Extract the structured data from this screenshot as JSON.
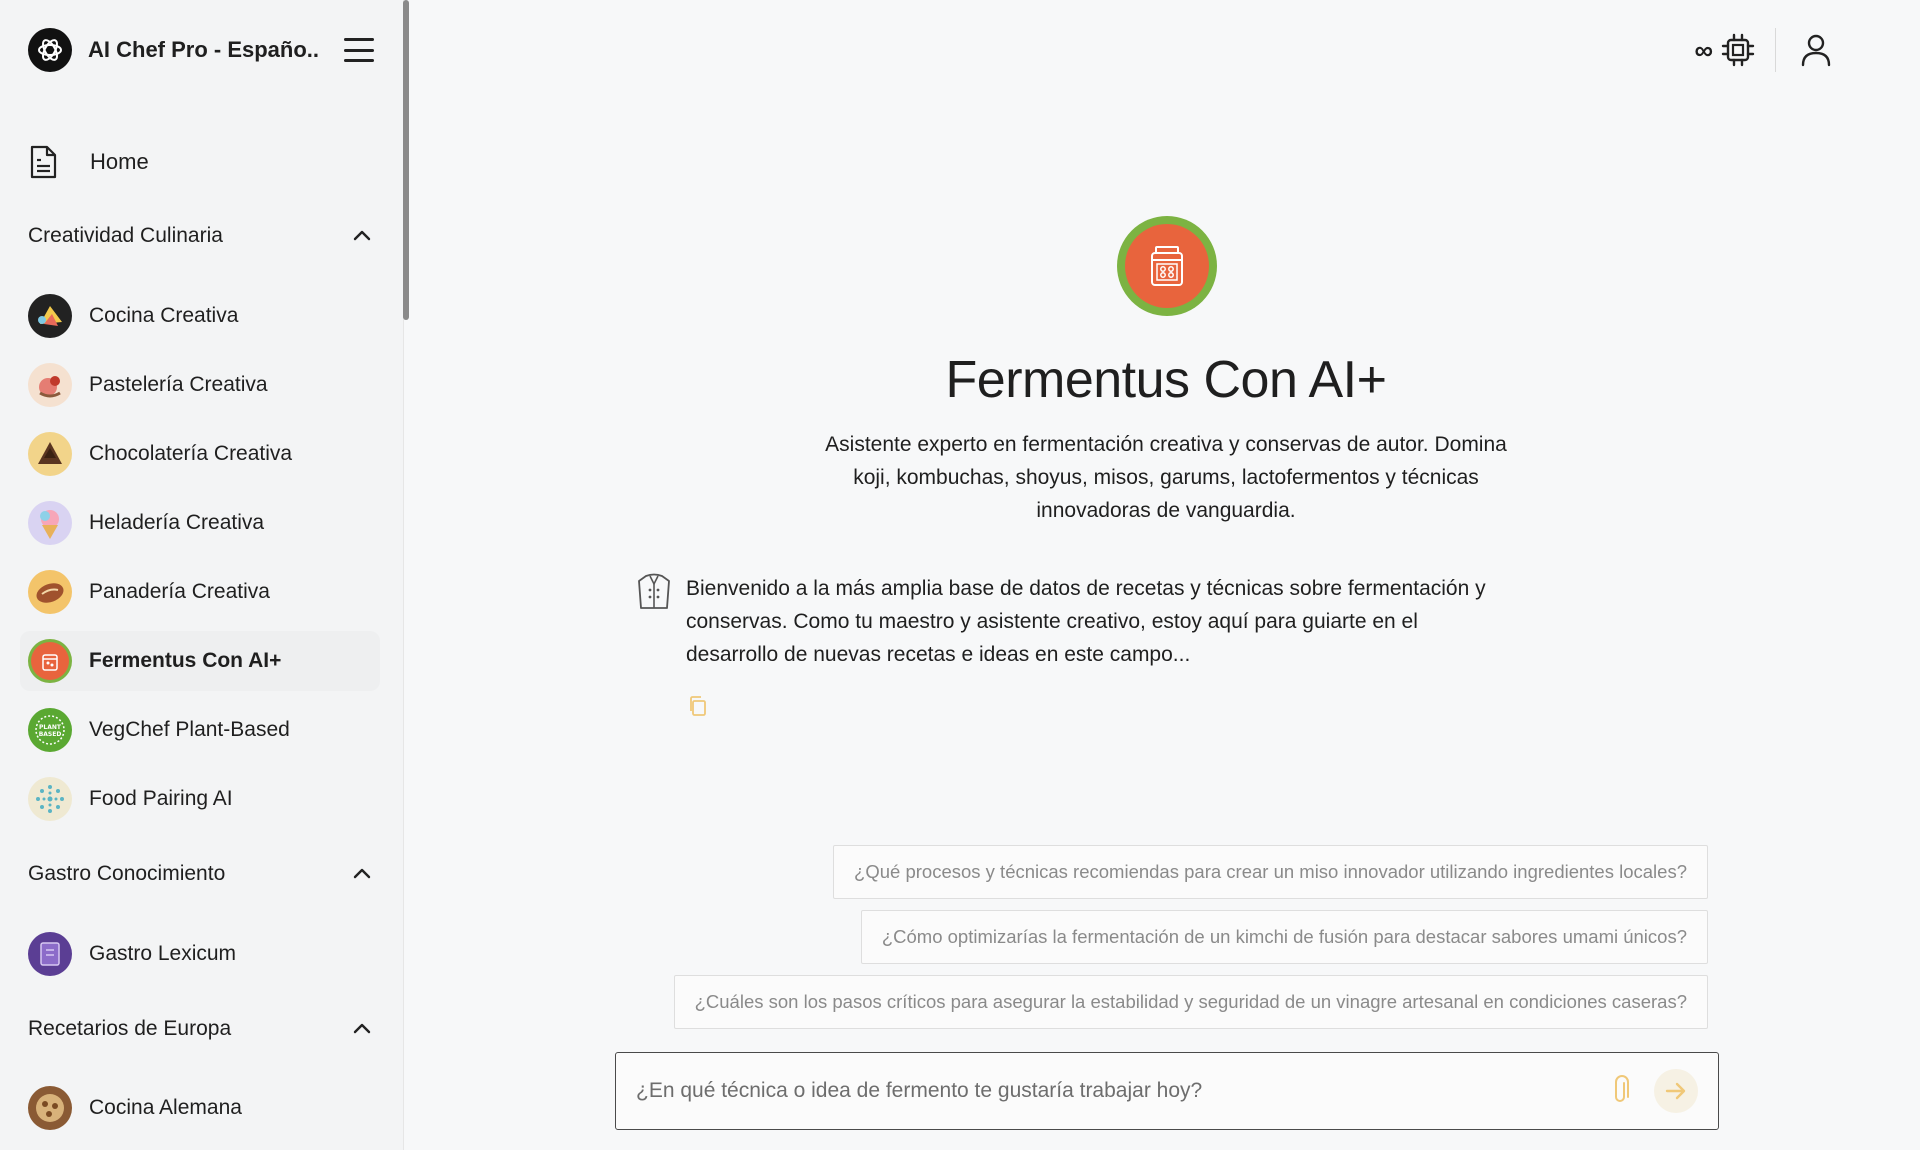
{
  "app": {
    "title": "AI Chef Pro - Españo..."
  },
  "sidebar": {
    "home_label": "Home",
    "sections": [
      {
        "title": "Creatividad Culinaria",
        "items": [
          {
            "label": "Cocina Creativa",
            "icon": "cocina-creativa-avatar"
          },
          {
            "label": "Pastelería Creativa",
            "icon": "pasteleria-creativa-avatar"
          },
          {
            "label": "Chocolatería Creativa",
            "icon": "chocolateria-creativa-avatar"
          },
          {
            "label": "Heladería Creativa",
            "icon": "heladeria-creativa-avatar"
          },
          {
            "label": "Panadería Creativa",
            "icon": "panaderia-creativa-avatar"
          },
          {
            "label": "Fermentus Con AI+",
            "icon": "fermentus-avatar",
            "active": true
          },
          {
            "label": "VegChef Plant-Based",
            "icon": "vegchef-avatar"
          },
          {
            "label": "Food Pairing AI",
            "icon": "food-pairing-avatar"
          }
        ]
      },
      {
        "title": "Gastro Conocimiento",
        "items": [
          {
            "label": "Gastro Lexicum",
            "icon": "gastro-lexicum-avatar"
          }
        ]
      },
      {
        "title": "Recetarios de Europa",
        "items": [
          {
            "label": "Cocina Alemana",
            "icon": "cocina-alemana-avatar"
          }
        ]
      }
    ]
  },
  "topbar": {
    "infinity_label": "∞"
  },
  "assistant": {
    "name": "Fermentus Con AI+",
    "description": "Asistente experto en fermentación creativa y conservas de autor. Domina koji, kombuchas, shoyus, misos, garums, lactofermentos y técnicas innovadoras de vanguardia.",
    "welcome": "Bienvenido a la más amplia base de datos de recetas y técnicas sobre fermentación y conservas. Como tu maestro y asistente creativo, estoy aquí para guiarte en el desarrollo de nuevas recetas e ideas en este campo..."
  },
  "suggestions": [
    "¿Qué procesos y técnicas recomiendas para crear un miso innovador utilizando ingredientes locales?",
    "¿Cómo optimizarías la fermentación de un kimchi de fusión para destacar sabores umami únicos?",
    "¿Cuáles son los pasos críticos para asegurar la estabilidad y seguridad de un vinagre artesanal en condiciones caseras?"
  ],
  "chat": {
    "placeholder": "¿En qué técnica o idea de fermento te gustaría trabajar hoy?"
  },
  "colors": {
    "accent_orange": "#e8643d",
    "accent_green": "#7cb342",
    "send_arrow": "#f0c878"
  }
}
